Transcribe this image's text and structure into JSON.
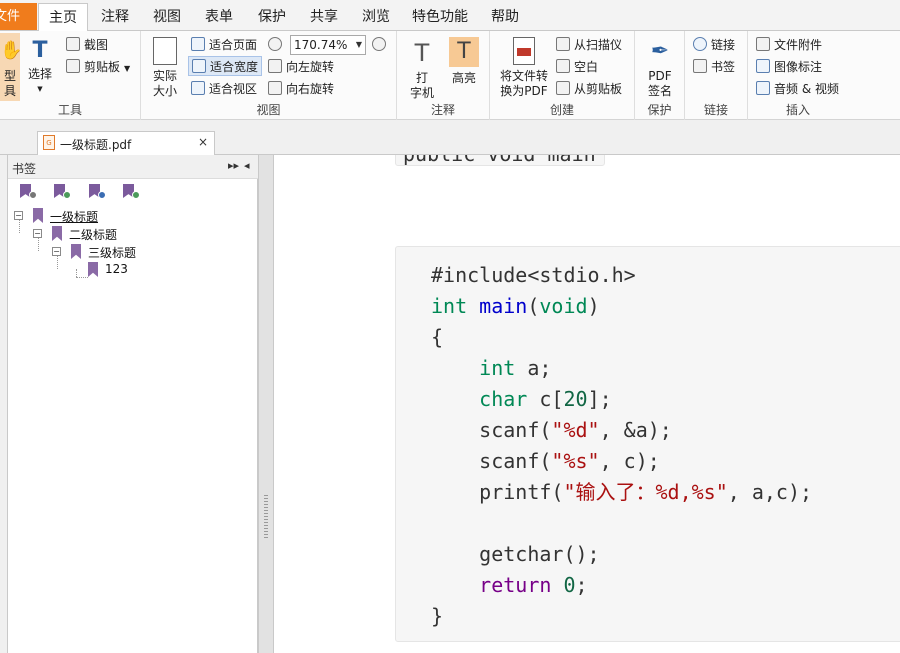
{
  "menu": {
    "file": "文件",
    "items": [
      "主页",
      "注释",
      "视图",
      "表单",
      "保护",
      "共享",
      "浏览",
      "特色功能",
      "帮助"
    ],
    "active_index": 0
  },
  "ribbon": {
    "tools": {
      "hand_label_1": "型",
      "hand_label_2": "具",
      "select_label": "选择",
      "screenshot_label": "截图",
      "clipboard_label": "剪贴板",
      "group_label": "工具"
    },
    "view": {
      "actual_size_1": "实际",
      "actual_size_2": "大小",
      "fit_page": "适合页面",
      "fit_width": "适合宽度",
      "fit_visible": "适合视区",
      "zoom_value": "170.74%",
      "rotate_left": "向左旋转",
      "rotate_right": "向右旋转",
      "group_label": "视图"
    },
    "annotate": {
      "typewriter_1": "打",
      "typewriter_2": "字机",
      "highlight": "高亮",
      "group_label": "注释"
    },
    "create": {
      "convert_1": "将文件转",
      "convert_2": "换为PDF",
      "from_scanner": "从扫描仪",
      "blank": "空白",
      "from_clipboard": "从剪贴板",
      "group_label": "创建"
    },
    "protect": {
      "sign_1": "PDF",
      "sign_2": "签名",
      "group_label": "保护"
    },
    "links": {
      "link": "链接",
      "bookmark": "书签",
      "group_label": "链接"
    },
    "insert": {
      "attachment": "文件附件",
      "image_annot": "图像标注",
      "audio_video": "音频 & 视频",
      "group_label": "插入"
    }
  },
  "tab": {
    "filename": "一级标题.pdf",
    "close": "×"
  },
  "bookmarks": {
    "title": "书签",
    "expand_ctrl": "▸▸",
    "collapse_ctrl": "◂",
    "tree": [
      {
        "label": "一级标题",
        "level": 0
      },
      {
        "label": "二级标题",
        "level": 1
      },
      {
        "label": "三级标题",
        "level": 2
      },
      {
        "label": "123",
        "level": 3
      }
    ]
  },
  "document": {
    "top_code": "public void main",
    "code_lines": [
      "#include<stdio.h>",
      "int main(void)",
      "{",
      "    int a;",
      "    char c[20];",
      "    scanf(\"%d\", &a);",
      "    scanf(\"%s\", c);",
      "    printf(\"输入了：%d,%s\", a,c);",
      "",
      "    getchar();",
      "    return 0;",
      "}"
    ]
  },
  "colors": {
    "accent_orange": "#f07c1c",
    "keyword_type": "#008855",
    "keyword_function": "#0000cc",
    "keyword_return": "#770088",
    "string": "#aa1111",
    "number": "#116644"
  }
}
